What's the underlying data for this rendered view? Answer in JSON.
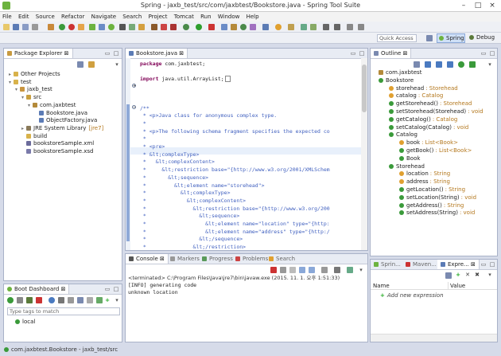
{
  "window": {
    "title": "Spring - jaxb_test/src/com/jaxbtest/Bookstore.java - Spring Tool Suite"
  },
  "menu": [
    "File",
    "Edit",
    "Source",
    "Refactor",
    "Navigate",
    "Search",
    "Project",
    "Tomcat",
    "Run",
    "Window",
    "Help"
  ],
  "quick_access": {
    "placeholder": "Quick Access"
  },
  "perspectives": {
    "spring": "Spring",
    "debug": "Debug"
  },
  "package_explorer": {
    "title": "Package Explorer",
    "items": [
      {
        "label": "Other Projects",
        "level": 0,
        "icon": "folder-icon"
      },
      {
        "label": "test",
        "level": 0,
        "icon": "folder-icon"
      },
      {
        "label": "jaxb_test",
        "level": 1,
        "icon": "project-icon"
      },
      {
        "label": "src",
        "level": 2,
        "icon": "source-folder-icon"
      },
      {
        "label": "com.jaxbtest",
        "level": 3,
        "icon": "package-icon"
      },
      {
        "label": "Bookstore.java",
        "level": 4,
        "icon": "java-file-icon"
      },
      {
        "label": "ObjectFactory.java",
        "level": 4,
        "icon": "java-file-icon"
      },
      {
        "label": "JRE System Library",
        "suffix": "[jre7]",
        "level": 2,
        "icon": "library-icon"
      },
      {
        "label": "build",
        "level": 2,
        "icon": "folder-icon"
      },
      {
        "label": "bookstoreSample.xml",
        "level": 2,
        "icon": "xml-file-icon"
      },
      {
        "label": "bookstoreSample.xsd",
        "level": 2,
        "icon": "xsd-file-icon"
      }
    ]
  },
  "boot_dashboard": {
    "title": "Boot Dashboard",
    "filter_placeholder": "Type tags to match",
    "items": [
      "local"
    ]
  },
  "editor": {
    "tab": "Bookstore.java",
    "lines": [
      {
        "type": "pkg",
        "text": "package com.jaxbtest;"
      },
      {
        "type": "blank",
        "text": ""
      },
      {
        "type": "import",
        "text": "import java.util.ArrayList;"
      },
      {
        "type": "blank",
        "text": ""
      },
      {
        "type": "blank",
        "text": ""
      },
      {
        "type": "cm",
        "text": "/**"
      },
      {
        "type": "cm",
        "text": " * <p>Java class for anonymous complex type."
      },
      {
        "type": "cm",
        "text": " * "
      },
      {
        "type": "cm",
        "text": " * <p>The following schema fragment specifies the expected co"
      },
      {
        "type": "cm",
        "text": " * "
      },
      {
        "type": "cm",
        "text": " * <pre>"
      },
      {
        "type": "cmh",
        "text": " * &lt;complexType>"
      },
      {
        "type": "cm",
        "text": " *   &lt;complexContent>"
      },
      {
        "type": "cm",
        "text": " *     &lt;restriction base=\"{http://www.w3.org/2001/XMLSchem"
      },
      {
        "type": "cm",
        "text": " *       &lt;sequence>"
      },
      {
        "type": "cm",
        "text": " *         &lt;element name=\"storehead\">"
      },
      {
        "type": "cm",
        "text": " *           &lt;complexType>"
      },
      {
        "type": "cm",
        "text": " *             &lt;complexContent>"
      },
      {
        "type": "cm",
        "text": " *               &lt;restriction base=\"{http://www.w3.org/200"
      },
      {
        "type": "cm",
        "text": " *                 &lt;sequence>"
      },
      {
        "type": "cm",
        "text": " *                   &lt;element name=\"location\" type=\"{http:"
      },
      {
        "type": "cm",
        "text": " *                   &lt;element name=\"address\" type=\"{http:/"
      },
      {
        "type": "cm",
        "text": " *                 &lt;/sequence>"
      },
      {
        "type": "cm",
        "text": " *               &lt;/restriction>"
      }
    ]
  },
  "outline": {
    "title": "Outline",
    "items": [
      {
        "label": "com.jaxbtest",
        "type": "",
        "level": 0,
        "icon": "package-icon"
      },
      {
        "label": "Bookstore",
        "type": "",
        "level": 0,
        "icon": "class-icon"
      },
      {
        "label": "storehead",
        "type": ": Storehead",
        "level": 1,
        "icon": "field-icon"
      },
      {
        "label": "catalog",
        "type": ": Catalog",
        "level": 1,
        "icon": "field-icon"
      },
      {
        "label": "getStorehead()",
        "type": ": Storehead",
        "level": 1,
        "icon": "method-icon"
      },
      {
        "label": "setStorehead(Storehead)",
        "type": ": void",
        "level": 1,
        "icon": "method-icon"
      },
      {
        "label": "getCatalog()",
        "type": ": Catalog",
        "level": 1,
        "icon": "method-icon"
      },
      {
        "label": "setCatalog(Catalog)",
        "type": ": void",
        "level": 1,
        "icon": "method-icon"
      },
      {
        "label": "Catalog",
        "type": "",
        "level": 1,
        "icon": "class-icon"
      },
      {
        "label": "book",
        "type": ": List<Book>",
        "level": 2,
        "icon": "field-icon"
      },
      {
        "label": "getBook()",
        "type": ": List<Book>",
        "level": 2,
        "icon": "method-icon"
      },
      {
        "label": "Book",
        "type": "",
        "level": 2,
        "icon": "class-icon"
      },
      {
        "label": "Storehead",
        "type": "",
        "level": 1,
        "icon": "class-icon"
      },
      {
        "label": "location",
        "type": ": String",
        "level": 2,
        "icon": "field-icon"
      },
      {
        "label": "address",
        "type": ": String",
        "level": 2,
        "icon": "field-icon"
      },
      {
        "label": "getLocation()",
        "type": ": String",
        "level": 2,
        "icon": "method-icon"
      },
      {
        "label": "setLocation(String)",
        "type": ": void",
        "level": 2,
        "icon": "method-icon"
      },
      {
        "label": "getAddress()",
        "type": ": String",
        "level": 2,
        "icon": "method-icon"
      },
      {
        "label": "setAddress(String)",
        "type": ": void",
        "level": 2,
        "icon": "method-icon"
      }
    ]
  },
  "console": {
    "tabs": [
      "Console",
      "Markers",
      "Progress",
      "Problems",
      "Search"
    ],
    "header": "<terminated> C:\\Program Files\\Java\\jre7\\bin\\javaw.exe (2015. 11. 1. 오후 1:51:33)",
    "lines": [
      "[INFO] generating code",
      "unknown location"
    ]
  },
  "expressions": {
    "tabs": [
      "Sprin...",
      "Maven...",
      "Expre..."
    ],
    "columns": [
      "Name",
      "Value"
    ],
    "add_label": "Add new expression"
  },
  "status": {
    "text": "com.jaxbtest.Bookstore - jaxb_test/src"
  }
}
